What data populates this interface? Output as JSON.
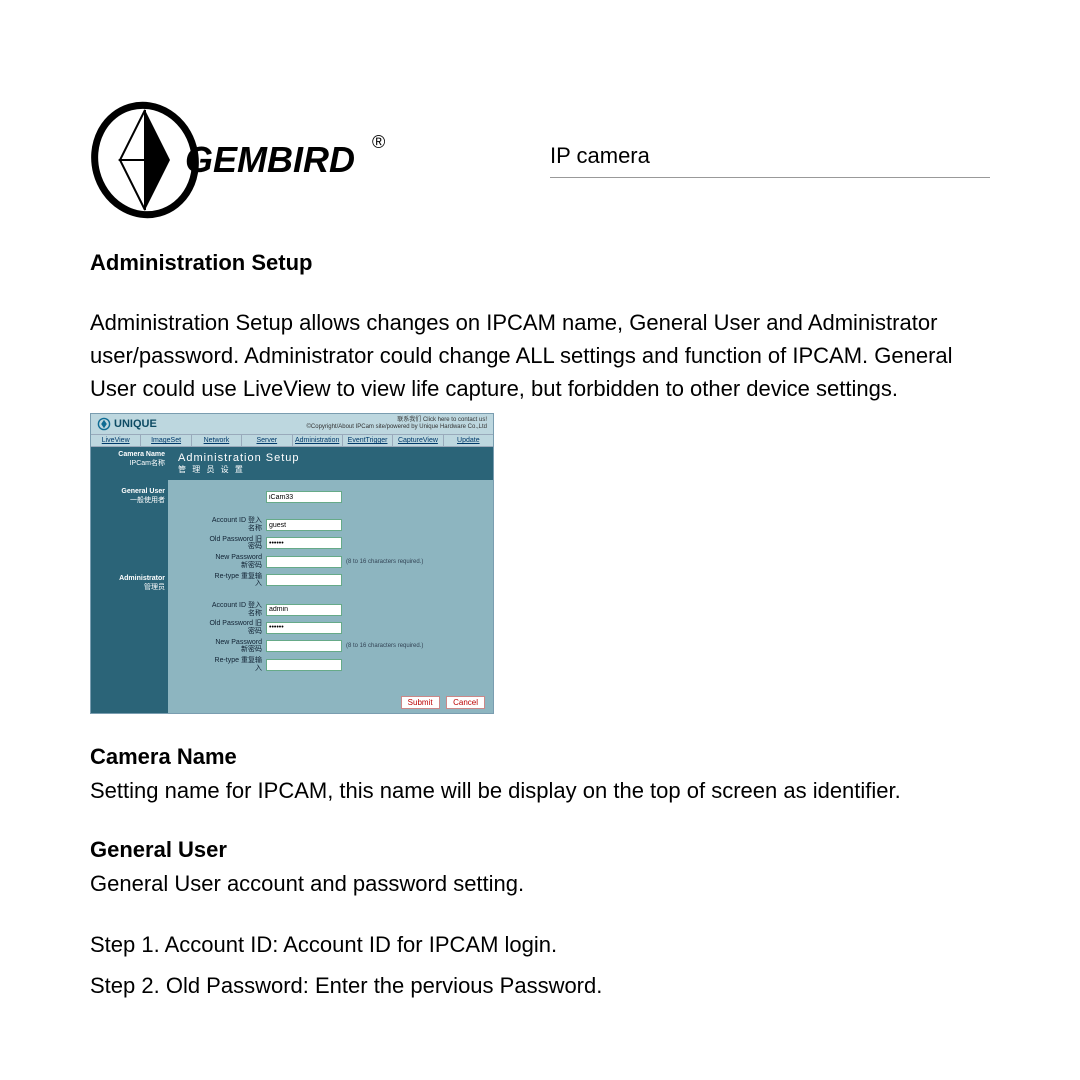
{
  "header": {
    "brand": "GEMBIRD",
    "title": "IP camera"
  },
  "section_title": "Administration Setup",
  "intro": "Administration Setup allows changes on IPCAM name, General User and Administrator user/password. Administrator could change ALL settings and function of IPCAM. General User could use LiveView to view life capture, but forbidden to other device settings.",
  "screenshot": {
    "brand": "UNIQUE",
    "topmsg_line1": "联系我们 Click here to contact us!",
    "topmsg_line2": "©Copyright/About IPCam site/powered by Unique Hardware Co.,Ltd",
    "tabs": [
      "LiveView",
      "ImageSet",
      "Network",
      "Server",
      "Administration",
      "EventTrigger",
      "CaptureView",
      "Update"
    ],
    "panel_title": "Administration Setup",
    "panel_subtitle": "管 理 员 设 置",
    "side": {
      "camera_name": {
        "en": "Camera Name",
        "zh": "IPCam名称"
      },
      "general_user": {
        "en": "General User",
        "zh": "一般使用者"
      },
      "administrator": {
        "en": "Administrator",
        "zh": "管理员"
      }
    },
    "fields": {
      "camera_name_value": "iCam33",
      "account_id_label": "Account ID\n登入名称",
      "old_pw_label": "Old Password\n旧密码",
      "new_pw_label": "New Password\n新密码",
      "retype_label": "Re-type\n重复输入",
      "hint": "(8 to 16 characters required.)",
      "guest_id": "guest",
      "guest_oldpw": "••••••",
      "admin_id": "admin",
      "admin_oldpw": "••••••"
    },
    "buttons": {
      "submit": "Submit",
      "cancel": "Cancel"
    }
  },
  "camera_name": {
    "title": "Camera Name",
    "body": "Setting name for IPCAM, this name will be display on the top of screen as identifier."
  },
  "general_user": {
    "title": "General User",
    "body": "General User account and password setting.",
    "step1": "Step 1. Account ID: Account ID for IPCAM login.",
    "step2": "Step 2. Old Password: Enter the pervious Password."
  }
}
